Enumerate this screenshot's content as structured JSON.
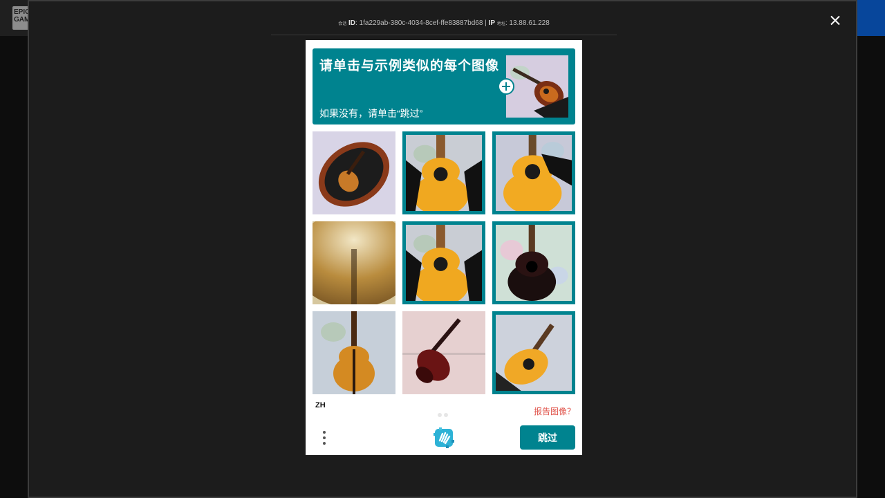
{
  "site": {
    "logo_text": "EPIC GAMES"
  },
  "modal": {
    "session_prefix": "会话",
    "id_label": "ID",
    "session_id": ": 1fa229ab-380c-4034-8cef-ffe83887bd68 | ",
    "ip_label": "IP",
    "ip_prefix": "地址",
    "ip_value": ": 13.88.61.228"
  },
  "captcha": {
    "title": "请单击与示例类似的每个图像",
    "subtitle": "如果没有，请单击“跳过”",
    "example_image": "acoustic-guitar-sunburst",
    "tiles": [
      {
        "image": "violin-in-case",
        "selected": false
      },
      {
        "image": "acoustic-guitar",
        "selected": true
      },
      {
        "image": "acoustic-guitar-dark-cutaway",
        "selected": true
      },
      {
        "image": "cymbal",
        "selected": false
      },
      {
        "image": "acoustic-guitar",
        "selected": true
      },
      {
        "image": "black-acoustic-guitar",
        "selected": true
      },
      {
        "image": "violin",
        "selected": false
      },
      {
        "image": "red-violin",
        "selected": false
      },
      {
        "image": "acoustic-guitar-cutaway",
        "selected": true
      }
    ],
    "language": "ZH",
    "report_label": "报告图像？",
    "submit_label": "跳过",
    "colors": {
      "accent": "#00838f",
      "report": "#e0534a"
    }
  }
}
